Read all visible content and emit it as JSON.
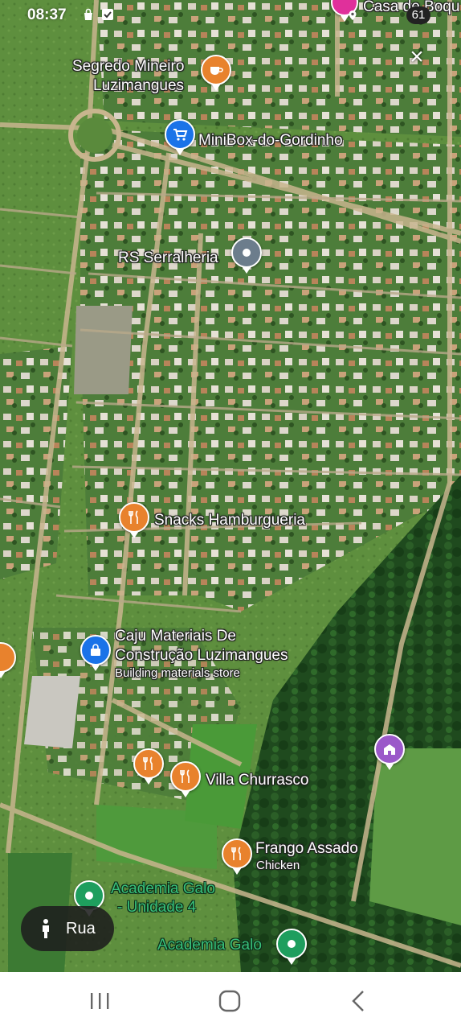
{
  "status_bar": {
    "time": "08:37",
    "icons": [
      "bag-icon",
      "check-box-icon"
    ]
  },
  "map": {
    "labels": {
      "casa": "Casa de Boqu",
      "casa_badge": "61",
      "segredo_line1": "Segredo Mineiro",
      "segredo_line2": "Luzimangues",
      "minibox": "MiniBox-do-Gordinho",
      "rs": "RS Serralheria",
      "snacks": "Snacks Hamburgueria",
      "caju_line1": "Caju Materiais De",
      "caju_line2": "Construção Luzimangues",
      "caju_sub": "Building materials store",
      "villa": "Villa Churrasco",
      "frango": "Frango Assado",
      "frango_sub": "Chicken",
      "academia4_line1": "Academia Galo",
      "academia4_line2": "- Unidade 4",
      "academia": "Academia Galo"
    },
    "pin_colors": {
      "cafe": "#e8822d",
      "food": "#e8822d",
      "shop": "#1a73e8",
      "service": "#6c7d8c",
      "fitness": "#1e9e5e",
      "landmark": "#9b59c9",
      "top": "#e0309b"
    }
  },
  "street_view_button": {
    "label": "Rua"
  },
  "nav_bar": {
    "items": [
      "recent-apps-button",
      "home-button",
      "back-button"
    ]
  }
}
